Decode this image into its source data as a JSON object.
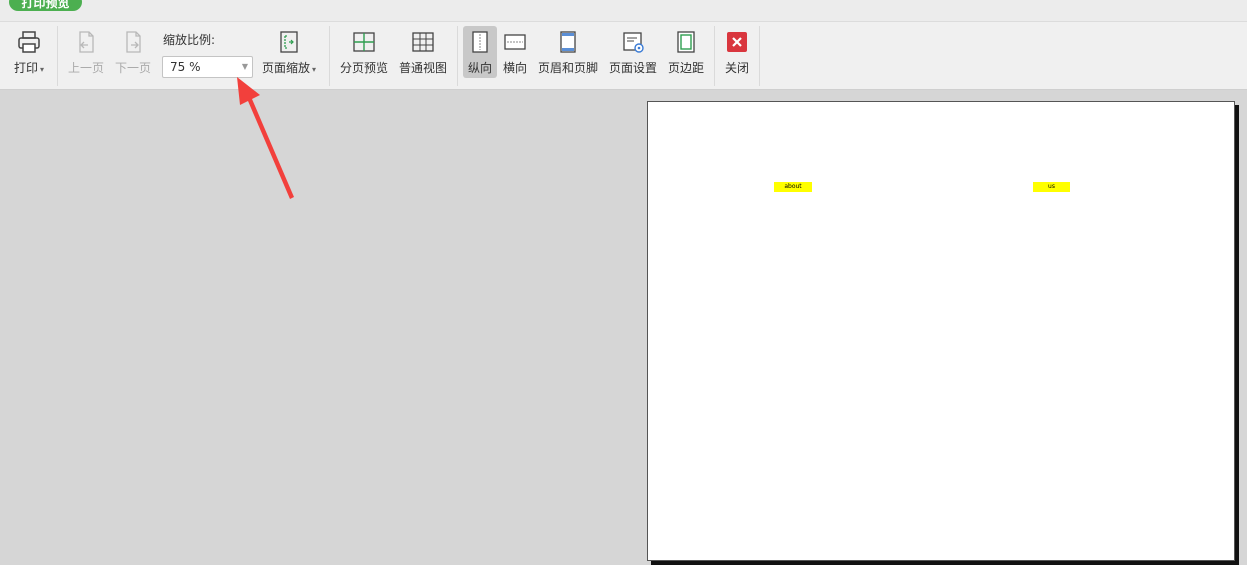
{
  "title_tab": "打印预览",
  "toolbar": {
    "print": "打印",
    "prev_page": "上一页",
    "next_page": "下一页",
    "zoom_label": "缩放比例:",
    "zoom_value": "75 %",
    "page_zoom": "页面缩放",
    "page_break_preview": "分页预览",
    "normal_view": "普通视图",
    "portrait": "纵向",
    "landscape": "横向",
    "header_footer": "页眉和页脚",
    "page_setup": "页面设置",
    "margins": "页边距",
    "close": "关闭"
  },
  "sheet": {
    "cell_1": "about",
    "cell_2": "us"
  },
  "colors": {
    "accent_green": "#4caf50",
    "close_red": "#d9363e",
    "highlight_yellow": "#ffff00",
    "arrow_red": "#f2403c"
  }
}
